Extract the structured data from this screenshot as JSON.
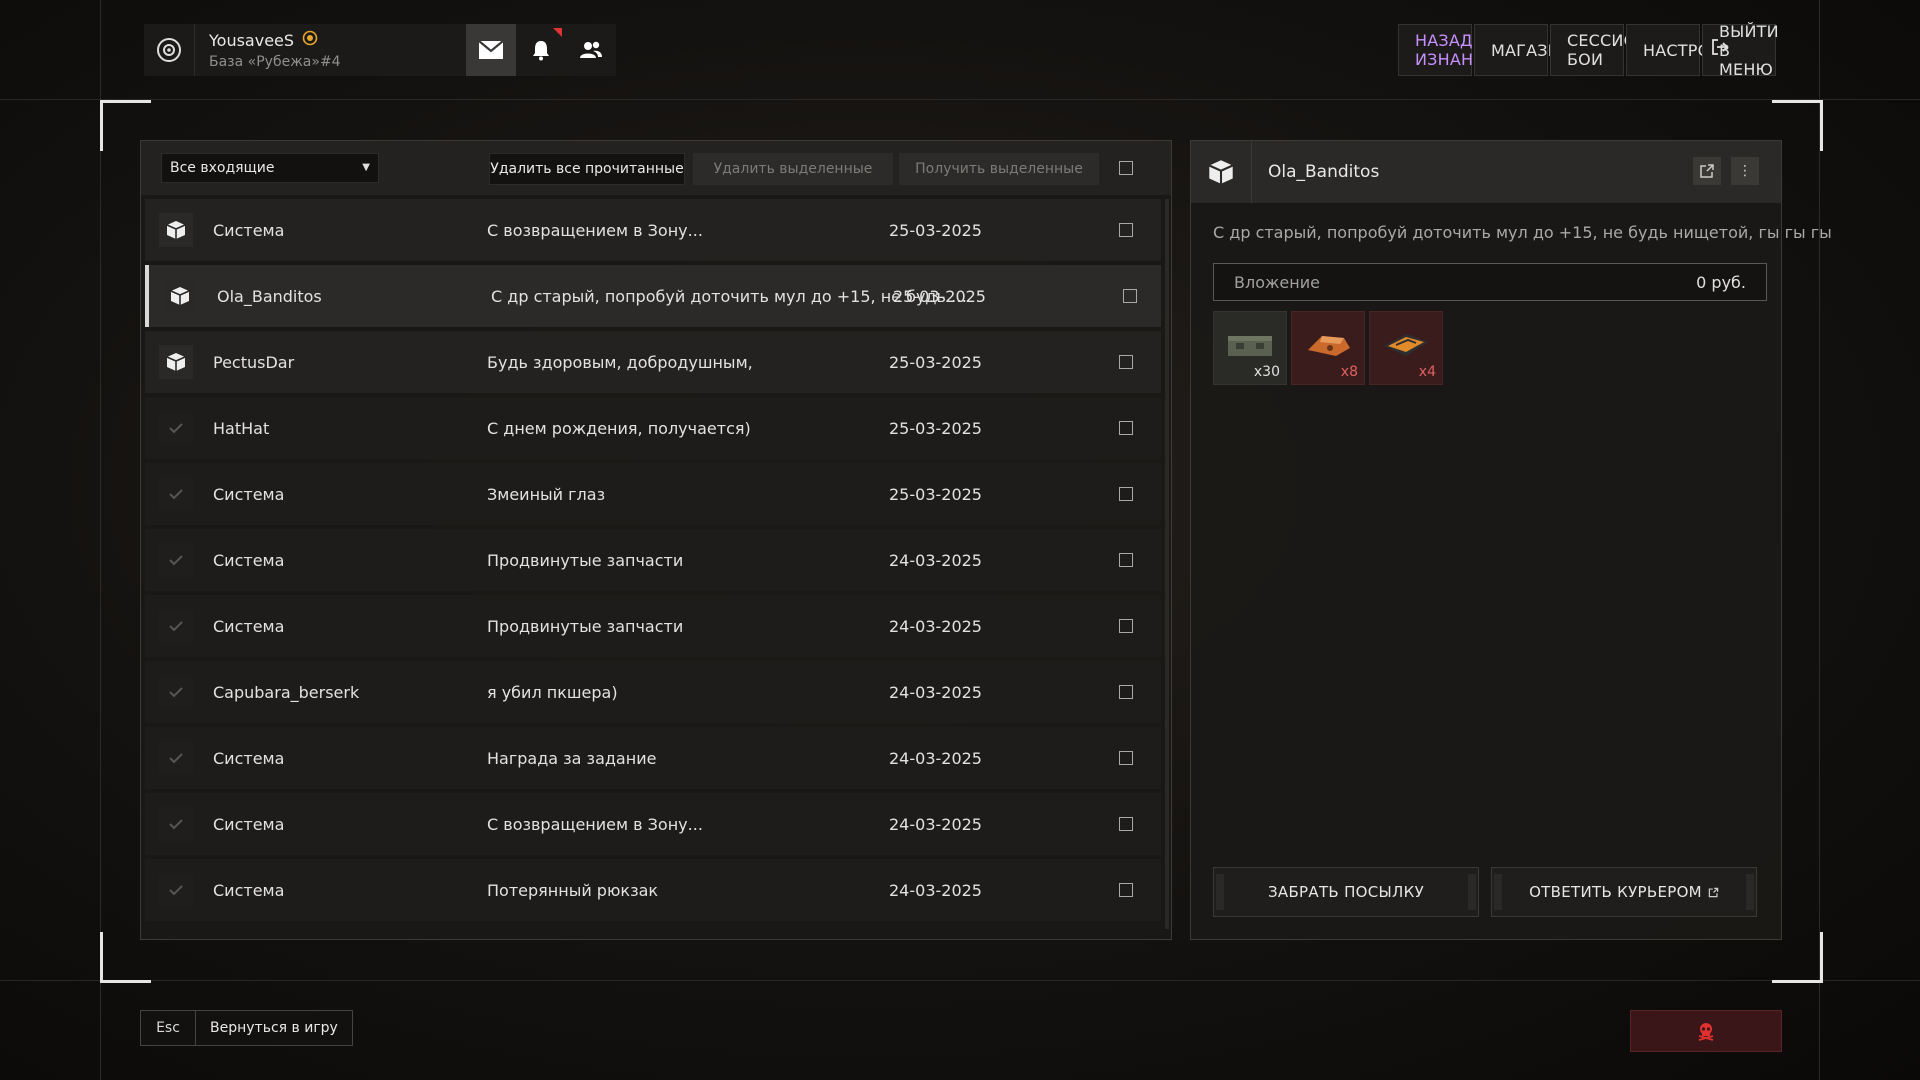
{
  "user": {
    "name": "YousaveeS",
    "base": "База «Рубежа»#4"
  },
  "nav": [
    "НАЗАД В ИЗНАНКУ",
    "МАГАЗИН",
    "СЕССИОННЫЕ БОИ",
    "НАСТРОЙКИ",
    "ВЫЙТИ В МЕНЮ"
  ],
  "toolbar": {
    "filter": "Все входящие",
    "delete_read": "Удалить все прочитанные",
    "delete_selected": "Удалить выделенные",
    "get_selected": "Получить выделенные"
  },
  "messages": [
    {
      "sender": "Система",
      "subject": "С возвращением в Зону...",
      "date": "25-03-2025"
    },
    {
      "sender": "Ola_Banditos",
      "subject": "С др старый, попробуй доточить мул до +15, не будь нищетой, гы гы гы",
      "date": "25-03-2025"
    },
    {
      "sender": "PectusDar",
      "subject": "Будь здоровым, добродушным,",
      "date": "25-03-2025"
    },
    {
      "sender": "HatHat",
      "subject": "С днем рождения, получается)",
      "date": "25-03-2025"
    },
    {
      "sender": "Система",
      "subject": "Змеиный глаз",
      "date": "25-03-2025"
    },
    {
      "sender": "Система",
      "subject": "Продвинутые запчасти",
      "date": "24-03-2025"
    },
    {
      "sender": "Система",
      "subject": "Продвинутые запчасти",
      "date": "24-03-2025"
    },
    {
      "sender": "Capubara_berserk",
      "subject": "я убил пкшера)",
      "date": "24-03-2025"
    },
    {
      "sender": "Система",
      "subject": "Награда за задание",
      "date": "24-03-2025"
    },
    {
      "sender": "Система",
      "subject": "С возвращением в Зону...",
      "date": "24-03-2025"
    },
    {
      "sender": "Система",
      "subject": "Потерянный рюкзак",
      "date": "24-03-2025"
    }
  ],
  "detail": {
    "sender": "Ola_Banditos",
    "text": "С др старый, попробуй доточить мул до +15, не будь нищетой, гы гы гы",
    "attachment_label": "Вложение",
    "attachment_value": "0 руб.",
    "items": [
      {
        "icon": "ammo-box-icon",
        "count": "x30"
      },
      {
        "icon": "upgrade-part-icon",
        "count": "x8"
      },
      {
        "icon": "upgrade-kit-icon",
        "count": "x4"
      }
    ],
    "take_button": "ЗАБРАТЬ ПОСЫЛКУ",
    "reply_button": "ОТВЕТИТЬ КУРЬЕРОМ"
  },
  "bottom": {
    "esc_key": "Esc",
    "back_label": "Вернуться в игру"
  },
  "colors": {
    "accent": "#c890ff",
    "danger": "#e03030"
  }
}
